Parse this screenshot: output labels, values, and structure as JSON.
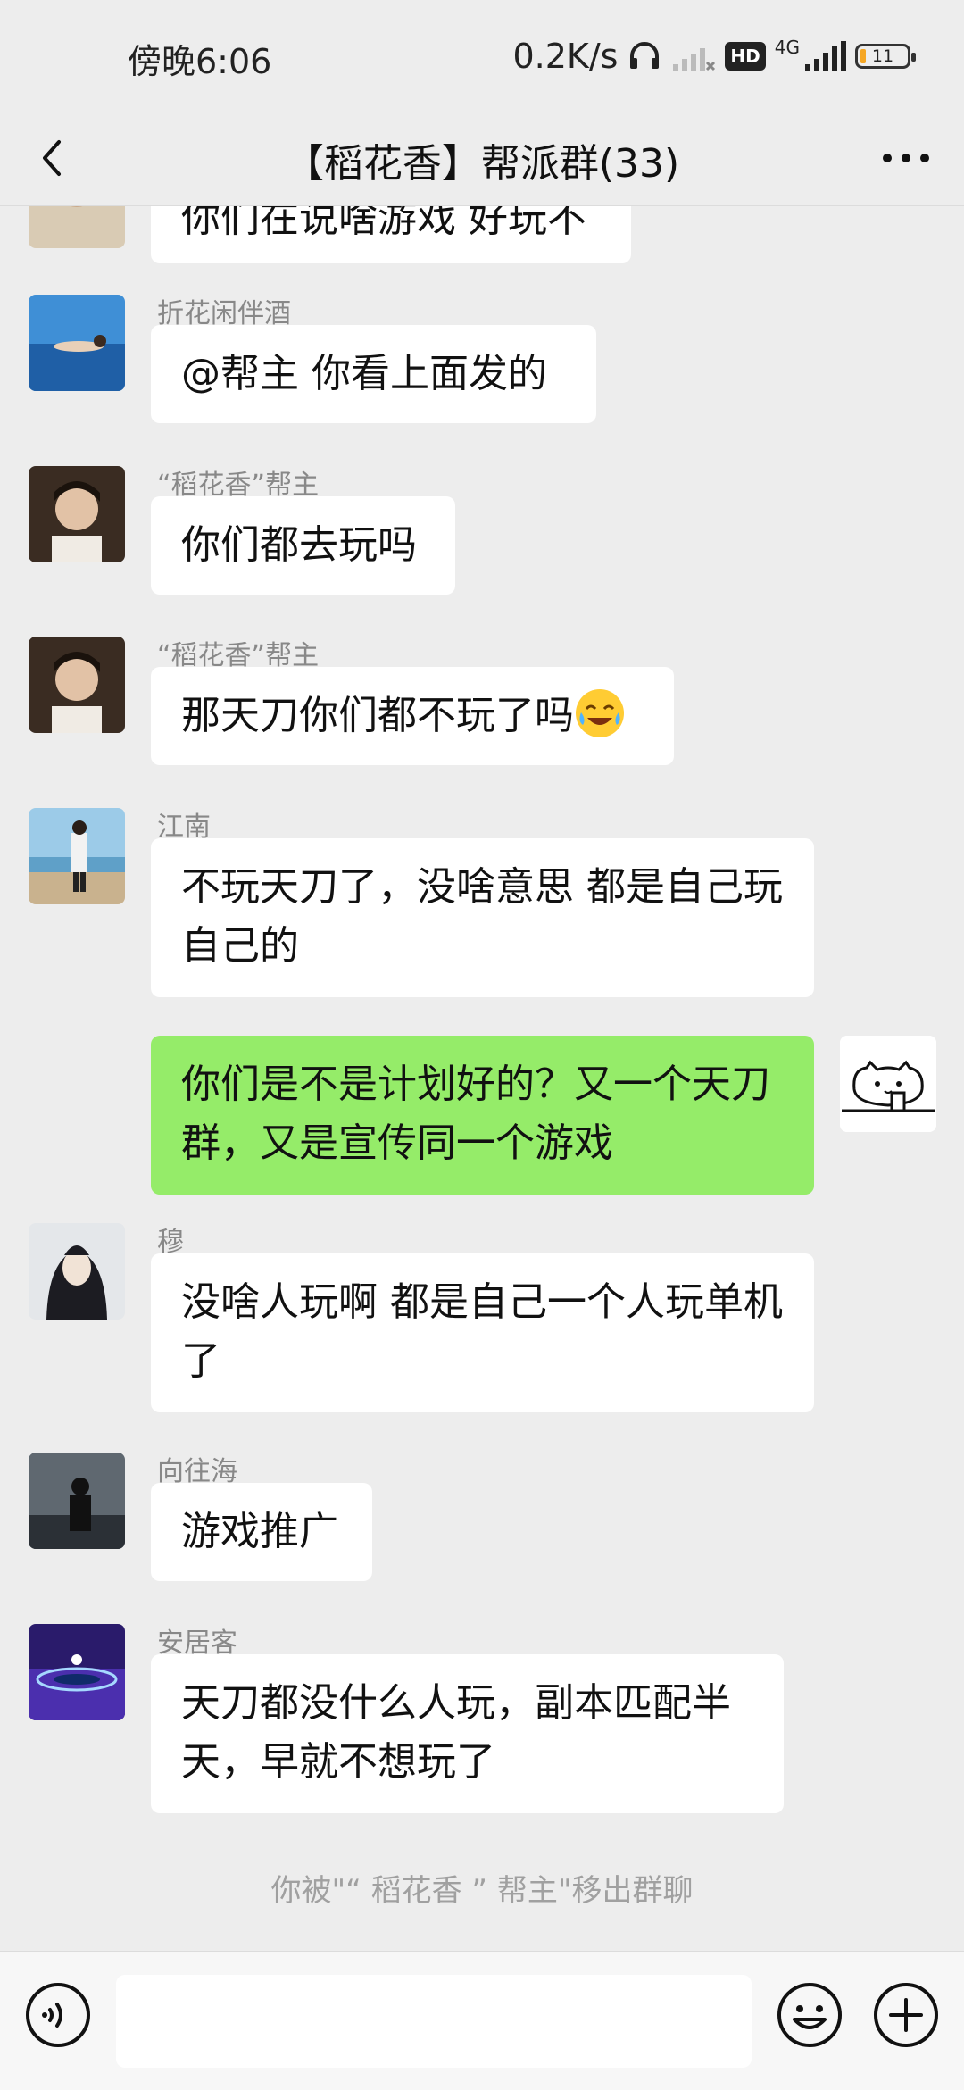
{
  "status_bar": {
    "time": "傍晚6:06",
    "net_speed": "0.2K/s",
    "hd": "HD",
    "network": "4G",
    "battery": "11"
  },
  "header": {
    "title": "【稻花香】帮派群(33)"
  },
  "messages": [
    {
      "sender": "",
      "text": "你们在说啥游戏 好玩不"
    },
    {
      "sender": "折花闲伴酒",
      "text": "@帮主  你看上面发的"
    },
    {
      "sender": "“稻花香”帮主",
      "text": "你们都去玩吗"
    },
    {
      "sender": "“稻花香”帮主",
      "text": "那天刀你们都不玩了吗"
    },
    {
      "sender": "江南",
      "text": "不玩天刀了，没啥意思 都是自己玩自己的"
    },
    {
      "sender": "",
      "text": "你们是不是计划好的？又一个天刀群，又是宣传同一个游戏"
    },
    {
      "sender": "穆",
      "text": "没啥人玩啊 都是自己一个人玩单机了"
    },
    {
      "sender": "向往海",
      "text": "游戏推广"
    },
    {
      "sender": "安居客",
      "text": "天刀都没什么人玩，副本匹配半天，早就不想玩了"
    }
  ],
  "system_note": "你被\"“ 稻花香 ” 帮主\"移出群聊",
  "input": {
    "value": "",
    "placeholder": ""
  },
  "icons": {
    "back": "back-arrow-icon",
    "more": "more-dots-icon",
    "voice": "voice-icon",
    "emoji": "emoji-icon",
    "plus": "plus-icon"
  },
  "colors": {
    "background": "#ededed",
    "my_bubble": "#95ec69",
    "other_bubble": "#ffffff",
    "system_text": "#a0a0a0"
  }
}
